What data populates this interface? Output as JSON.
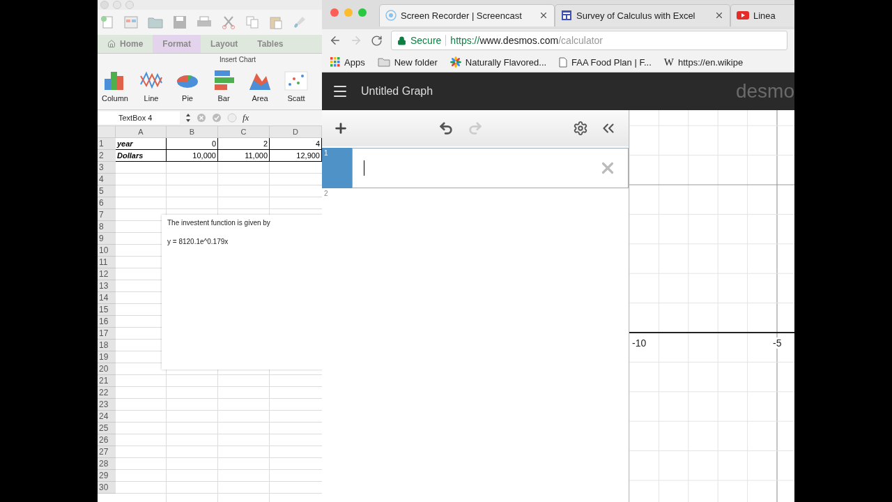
{
  "excel": {
    "ribbon_tabs": [
      {
        "label": "Home",
        "selected": false
      },
      {
        "label": "Format",
        "selected": true
      },
      {
        "label": "Layout",
        "selected": false
      },
      {
        "label": "Tables",
        "selected": false
      }
    ],
    "group_title": "Insert Chart",
    "chart_types": [
      {
        "label": "Column",
        "kind": "column"
      },
      {
        "label": "Line",
        "kind": "line"
      },
      {
        "label": "Pie",
        "kind": "pie"
      },
      {
        "label": "Bar",
        "kind": "bar"
      },
      {
        "label": "Area",
        "kind": "area"
      },
      {
        "label": "Scatt",
        "kind": "scatter"
      }
    ],
    "name_box": "TextBox 4",
    "formula_symbol": "fx",
    "columns": [
      "A",
      "B",
      "C",
      "D"
    ],
    "rows": [
      {
        "number": "1",
        "cells": [
          "year",
          "0",
          "2",
          "4"
        ]
      },
      {
        "number": "2",
        "cells": [
          "Dollars",
          "10,000",
          "11,000",
          "12,900"
        ]
      },
      {
        "number": "3"
      },
      {
        "number": "4"
      },
      {
        "number": "5"
      },
      {
        "number": "6"
      },
      {
        "number": "7"
      },
      {
        "number": "8"
      },
      {
        "number": "9"
      },
      {
        "number": "10"
      },
      {
        "number": "11"
      },
      {
        "number": "12"
      },
      {
        "number": "13"
      },
      {
        "number": "14"
      },
      {
        "number": "15"
      },
      {
        "number": "16"
      },
      {
        "number": "17"
      },
      {
        "number": "18"
      },
      {
        "number": "19"
      },
      {
        "number": "20"
      },
      {
        "number": "21"
      },
      {
        "number": "22"
      },
      {
        "number": "23"
      },
      {
        "number": "24"
      },
      {
        "number": "25"
      },
      {
        "number": "26"
      },
      {
        "number": "27"
      },
      {
        "number": "28"
      },
      {
        "number": "29"
      },
      {
        "number": "30"
      }
    ],
    "text_box": {
      "lines": [
        "The investent function is given by",
        "y = 8120.1e^0.179x"
      ]
    }
  },
  "browser": {
    "tabs": [
      {
        "label": "Screen Recorder | Screencast",
        "kind": "screencast",
        "selected": true,
        "closable": true
      },
      {
        "label": "Survey of Calculus with Excel",
        "kind": "sites",
        "selected": false,
        "closable": true
      },
      {
        "label": "Linea",
        "kind": "youtube",
        "selected": false,
        "closable": false
      }
    ],
    "address": {
      "secure_label": "Secure",
      "scheme": "https://",
      "host": "www.desmos.com",
      "path": "/calculator"
    },
    "bookmarks": [
      {
        "label": "Apps",
        "kind": "apps"
      },
      {
        "label": "New folder",
        "kind": "folder"
      },
      {
        "label": "Naturally Flavored...",
        "kind": "flower"
      },
      {
        "label": "FAA Food Plan | F...",
        "kind": "page"
      },
      {
        "label": "https://en.wikipe",
        "kind": "wiki",
        "icon_text": "W"
      }
    ]
  },
  "desmos": {
    "title": "Untitled Graph",
    "logo": "desmo",
    "redo_disabled": true,
    "expressions": [
      {
        "number": "1",
        "selected": true
      },
      {
        "number": "2",
        "selected": false
      }
    ],
    "axis_labels": [
      "-10",
      "-5"
    ]
  }
}
